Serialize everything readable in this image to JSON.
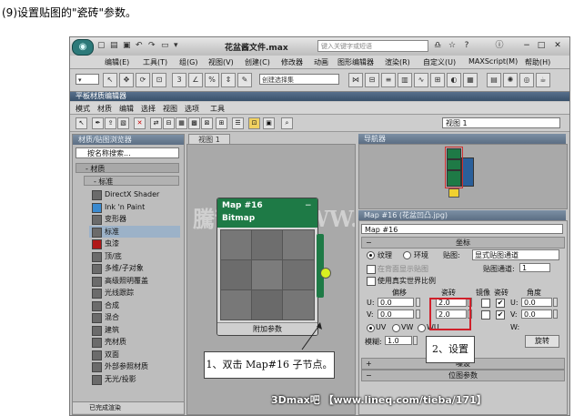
{
  "caption": "(9)设置贴图的\"瓷砖\"参数。",
  "app": {
    "window_title": "花盆酱文件.max",
    "search_placeholder": "键入关键字或短语",
    "menu": [
      "编辑(E)",
      "工具(T)",
      "组(G)",
      "视图(V)",
      "创建(C)",
      "修改器",
      "动画",
      "图形编辑器",
      "渲染(R)",
      "自定义(U)",
      "MAXScript(M)",
      "帮助(H)"
    ],
    "toolbar_dropdown": "创建选择集"
  },
  "slate": {
    "title": "平板材质编辑器",
    "menu": [
      "模式",
      "材质",
      "编辑",
      "选择",
      "视图",
      "选项",
      "工具"
    ],
    "view_select": "视图 1"
  },
  "browser": {
    "header": "材质/贴图浏览器",
    "search_placeholder": "按名称搜索...",
    "group_material": "- 材质",
    "group_standard": "- 标准",
    "items": [
      {
        "label": "DirectX Shader",
        "color": "#6b6b6b"
      },
      {
        "label": "Ink 'n Paint",
        "color": "#3a8ad0"
      },
      {
        "label": "变形器",
        "color": "#6b6b6b"
      },
      {
        "label": "标准",
        "color": "#6b6b6b"
      },
      {
        "label": "虫漆",
        "color": "#b01818"
      },
      {
        "label": "顶/底",
        "color": "#6b6b6b"
      },
      {
        "label": "多维/子对象",
        "color": "#6b6b6b"
      },
      {
        "label": "高级照明覆盖",
        "color": "#6b6b6b"
      },
      {
        "label": "光线跟踪",
        "color": "#6b6b6b"
      },
      {
        "label": "合成",
        "color": "#6b6b6b"
      },
      {
        "label": "混合",
        "color": "#6b6b6b"
      },
      {
        "label": "建筑",
        "color": "#6b6b6b"
      },
      {
        "label": "壳材质",
        "color": "#6b6b6b"
      },
      {
        "label": "双面",
        "color": "#6b6b6b"
      },
      {
        "label": "外部参照材质",
        "color": "#6b6b6b"
      },
      {
        "label": "无光/投影",
        "color": "#6b6b6b"
      }
    ],
    "status": "已完成渲染"
  },
  "view": {
    "tab": "视图 1",
    "watermark": "騰龍視覺WWW.TBI.NET",
    "node_title": "Map #16",
    "node_type": "Bitmap",
    "node_footer": "附加参数",
    "node_collapse": "−"
  },
  "navigator": {
    "header": "导航器"
  },
  "params": {
    "header": "Map #16 (花盆凹凸.jpg)",
    "name_field": "Map #16",
    "rollout_coords": "坐标",
    "texture": "纹理",
    "environ": "环境",
    "mapping_label": "贴图:",
    "mapping_value": "显式贴图通道",
    "show_map": "在背面显示贴图",
    "map_channel_label": "贴图通道:",
    "map_channel_value": "1",
    "real_world": "使用真实世界比例",
    "offset": "偏移",
    "tiling": "瓷砖",
    "mirror": "镜像",
    "tile": "瓷砖",
    "angle": "角度",
    "u_label": "U:",
    "v_label": "V:",
    "w_label": "W:",
    "u_offset": "0.0",
    "v_offset": "0.0",
    "u_tiling": "2.0",
    "v_tiling": "2.0",
    "u_angle": "0.0",
    "v_angle": "0.0",
    "uv": "UV",
    "vw": "VW",
    "wu": "WU",
    "blur_label": "模糊:",
    "blur_value": "1.0",
    "rotate_btn": "旋转",
    "rollout_noise": "噪波",
    "rollout_bitmap": "位图参数"
  },
  "annotations": {
    "step1": "1、双击 Map#16 子节点。",
    "step2": "2、设置",
    "bottom_watermark": "3Dmax吧 【www.lineq.com/tieba/171】"
  }
}
